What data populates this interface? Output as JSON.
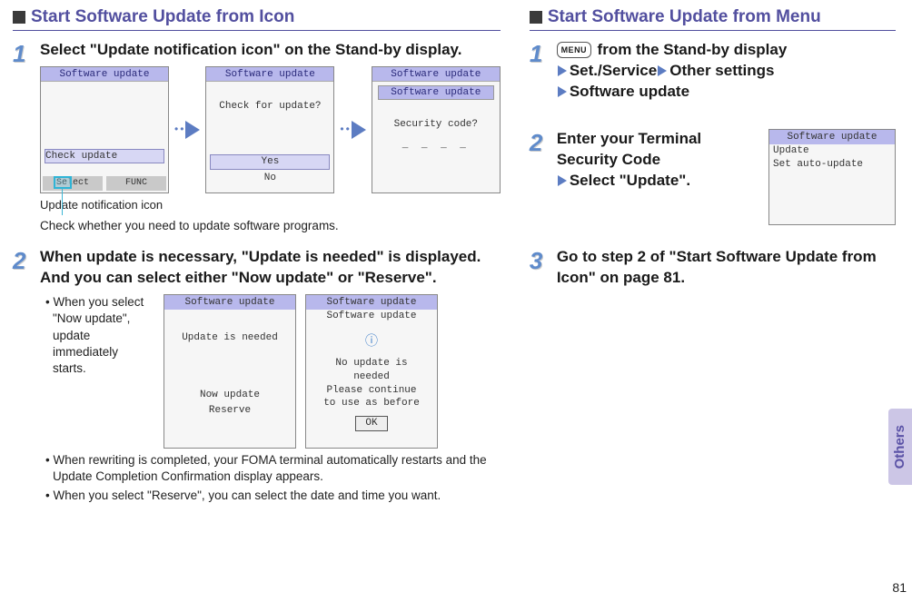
{
  "left": {
    "heading": "Start Software Update from Icon",
    "step1": {
      "num": "1",
      "main": "Select \"Update notification icon\" on the Stand-by display.",
      "shot1": {
        "title": "Software update",
        "row": "Check update",
        "btn_select": "Select",
        "btn_func": "FUNC"
      },
      "shot2": {
        "title": "Software update",
        "line1": "Check for update?",
        "yes": "Yes",
        "no": "No"
      },
      "shot3": {
        "title": "Software update",
        "subtitle": "Software update",
        "line1": "Security code?",
        "mask": "_ _ _ _"
      },
      "caption": "Update notification icon",
      "note": "Check whether you need to update software programs."
    },
    "step2": {
      "num": "2",
      "main": "When update is necessary, \"Update is needed\" is displayed. And you can select either \"Now update\" or \"Reserve\".",
      "shotA": {
        "title": "Software update",
        "line1": "Update is needed",
        "opt1": "Now update",
        "opt2": "Reserve"
      },
      "shotB": {
        "title": "Software update",
        "subtitle": "Software update",
        "l1": "No update is",
        "l2": "needed",
        "l3": "Please continue",
        "l4": "to use as before",
        "ok": "OK"
      },
      "b1": "When you select \"Now update\", update immediately starts.",
      "b2": "When rewriting is completed, your FOMA terminal automatically restarts and the Update Completion Confirmation display appears.",
      "b3": "When you select \"Reserve\", you can select the date and time you want."
    }
  },
  "right": {
    "heading": "Start Software Update from Menu",
    "step1": {
      "num": "1",
      "menu": "MENU",
      "t1": " from the Stand-by display",
      "nav1": "Set./Service",
      "nav2": "Other settings",
      "nav3": "Software update"
    },
    "step2": {
      "num": "2",
      "l1": "Enter your Terminal Security Code",
      "l2": "Select \"Update\".",
      "shot": {
        "title": "Software update",
        "row1": "Update",
        "row2": "Set auto-update"
      }
    },
    "step3": {
      "num": "3",
      "main": "Go to step 2 of \"Start Software Update from Icon\" on page 81."
    }
  },
  "sidetab": "Others",
  "page": "81"
}
